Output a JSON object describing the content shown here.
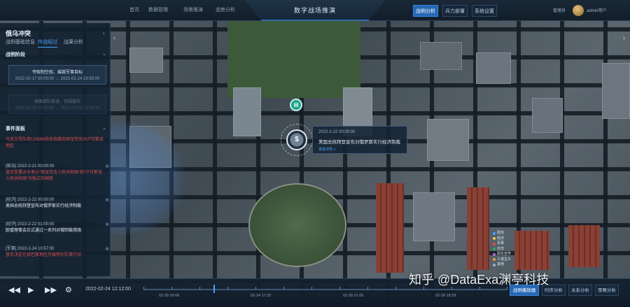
{
  "topbar": {
    "nav": [
      "首页",
      "数据管理",
      "场景推演",
      "态势分析"
    ],
    "title": "数字战场推演",
    "right_buttons": [
      {
        "label": "战例分析",
        "active": true
      },
      {
        "label": "兵力部署",
        "active": false
      },
      {
        "label": "系统设置",
        "active": false
      }
    ],
    "user_label": "管理员",
    "username": "admin用户"
  },
  "panel": {
    "title": "俄乌冲突",
    "collapse_icon": "chevron-left-icon",
    "tabs": [
      {
        "label": "战例基础信息",
        "active": false
      },
      {
        "label": "作战经过",
        "active": true
      },
      {
        "label": "战果分析",
        "active": false
      }
    ],
    "stage_header": "战例阶段",
    "stages": [
      {
        "name": "夺取制空权、摧毁军事目标",
        "time": "2022-02-17 00:00:00 → 2022-02-24 23:59:00",
        "dim": false
      },
      {
        "name": "地面部队推进、包围城市",
        "time": "2022-02-25 00:00:00 → 2022-03-01 23:59:00",
        "dim": true
      }
    ],
    "event_header": "事件面板",
    "events": [
      {
        "head": "",
        "body": "乌克兰军队用120MM迫击炮袭击顿涅茨克州卢甘斯克地区",
        "red": true,
        "plus": false
      },
      {
        "head": "[政治] 2022-2-21 00:00:00",
        "body": "普京签署法令承认“顿涅茨克人民共和国”和“卢甘斯克人民共和国”为独立的国家",
        "red": true,
        "plus": true
      },
      {
        "head": "[经济] 2022-2-22 00:00:00",
        "body": "美国总统拜登宣布对俄罗斯实行经济制裁",
        "red": false,
        "plus": true
      },
      {
        "head": "[经济] 2022-2-22 01:00:00",
        "body": "欧盟理事会正式通过一系列对俄制裁措施",
        "red": false,
        "plus": true
      },
      {
        "head": "[军事] 2022-2-24 10:57:00",
        "body": "普京决定在顿巴斯地区开展特别军事行动",
        "red": true,
        "plus": true
      }
    ]
  },
  "popup": {
    "time": "2022-2-22 00:00:00",
    "text": "美国总统拜登宣布对俄罗斯实行经济制裁",
    "link": "查看详情 >"
  },
  "marker_symbol": "$",
  "pin_icon": "document-icon",
  "legend": [
    {
      "label": "政治",
      "color": "#4aa3ff"
    },
    {
      "label": "经济",
      "color": "#f2c94c"
    },
    {
      "label": "军事",
      "color": "#e04e4e"
    },
    {
      "label": "外交",
      "color": "#27ae60"
    },
    {
      "label": "舆论宣传",
      "color": "#bb6bd9"
    },
    {
      "label": "人道主义",
      "color": "#f2994a"
    },
    {
      "label": "其他",
      "color": "#9fb3c8"
    }
  ],
  "bottombar": {
    "controls": [
      "rewind-icon",
      "play-icon",
      "fast-forward-icon",
      "settings-icon"
    ],
    "timestamp": "2022-02-24 12:12:00",
    "ticks": [
      "02-26 09:06",
      "02-24 17:32",
      "02-26 01:05",
      "02-28 18:18"
    ],
    "buttons": [
      {
        "label": "战例播放器",
        "active": true
      },
      {
        "label": "时序分析",
        "active": false
      },
      {
        "label": "关系分析",
        "active": false
      },
      {
        "label": "策略分析",
        "active": false
      }
    ]
  },
  "watermark": "知乎 @DataExa渊亭科技"
}
